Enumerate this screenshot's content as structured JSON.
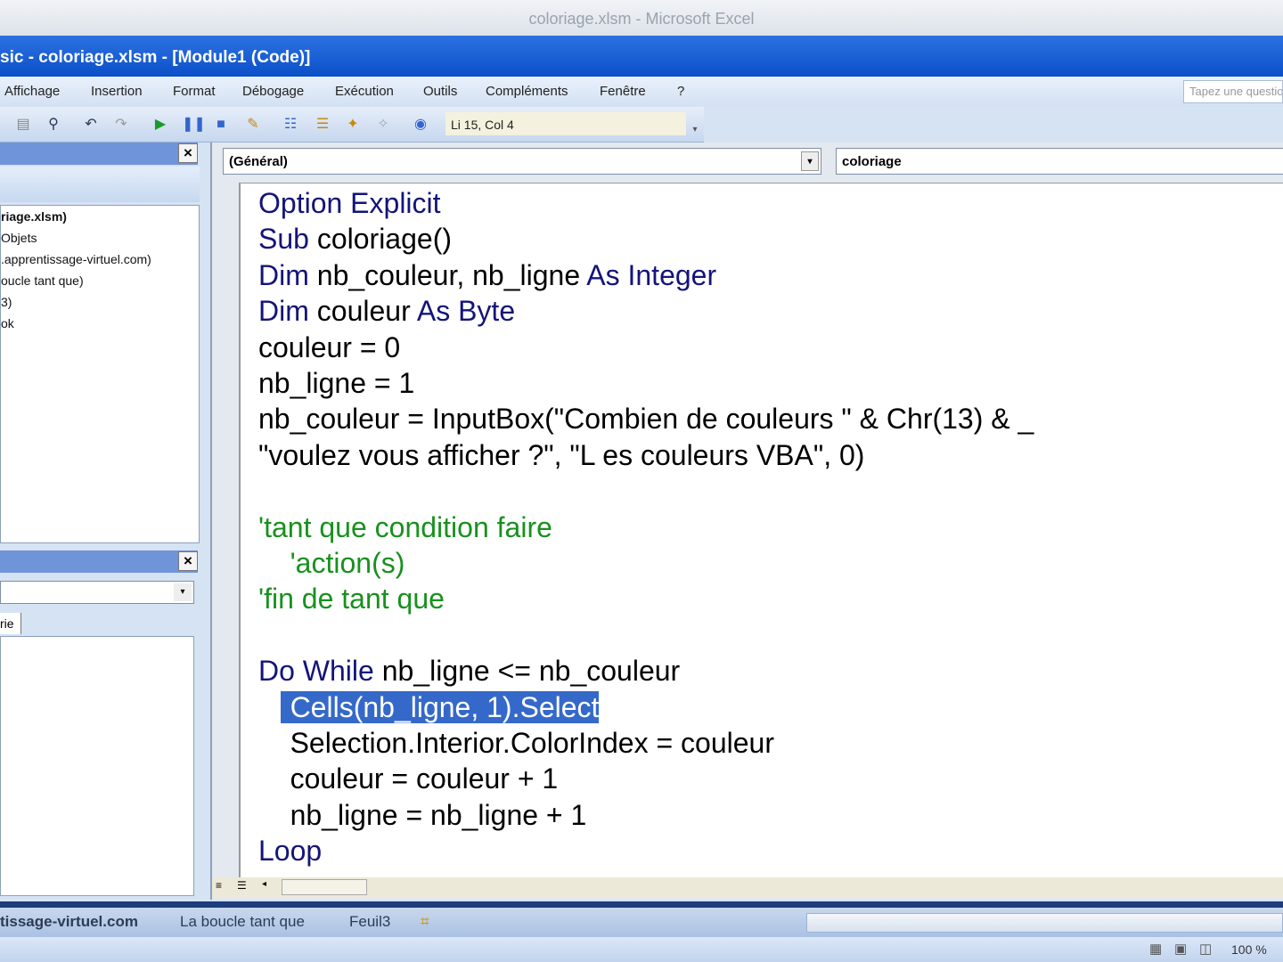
{
  "excel_title": "coloriage.xlsm - Microsoft Excel",
  "vbe_title": "sic - coloriage.xlsm - [Module1 (Code)]",
  "menu": [
    "Affichage",
    "Insertion",
    "Format",
    "Débogage",
    "Exécution",
    "Outils",
    "Compléments",
    "Fenêtre",
    "?"
  ],
  "help_placeholder": "Tapez une question",
  "cursor_position": "Li 15, Col 4",
  "project_tree": [
    "riage.xlsm)",
    "Objets",
    ".apprentissage-virtuel.com)",
    "oucle tant que)",
    "3)",
    "ok"
  ],
  "properties_tab": "rie",
  "object_combo": "(Général)",
  "procedure_combo": "coloriage",
  "code_lines": [
    [
      [
        "kw",
        "Option Explicit"
      ]
    ],
    [
      [
        "kw",
        "Sub "
      ],
      [
        "",
        "coloriage()"
      ]
    ],
    [
      [
        "kw",
        "Dim "
      ],
      [
        "",
        "nb_couleur, nb_ligne "
      ],
      [
        "kw",
        "As Integer"
      ]
    ],
    [
      [
        "kw",
        "Dim "
      ],
      [
        "",
        "couleur "
      ],
      [
        "kw",
        "As Byte"
      ]
    ],
    [
      [
        "",
        "couleur = 0"
      ]
    ],
    [
      [
        "",
        "nb_ligne = 1"
      ]
    ],
    [
      [
        "",
        "nb_couleur = InputBox(\"Combien de couleurs \" & Chr(13) & _"
      ]
    ],
    [
      [
        "",
        "\"voulez vous afficher ?\", \"L es couleurs VBA\", 0)"
      ]
    ],
    [],
    [
      [
        "cm",
        "'tant que condition faire"
      ]
    ],
    [
      [
        "cm",
        "    'action(s)"
      ]
    ],
    [
      [
        "cm",
        "'fin de tant que"
      ]
    ],
    [],
    [
      [
        "kw",
        "Do While "
      ],
      [
        "",
        "nb_ligne <= nb_couleur"
      ]
    ],
    [
      [
        "",
        "    "
      ],
      [
        "sel",
        "Cells(nb_ligne, 1).Select"
      ]
    ],
    [
      [
        "",
        "    Selection.Interior.ColorIndex = couleur"
      ]
    ],
    [
      [
        "",
        "    couleur = couleur + 1"
      ]
    ],
    [
      [
        "",
        "    nb_ligne = nb_ligne + 1"
      ]
    ],
    [
      [
        "kw",
        "Loop"
      ]
    ]
  ],
  "sheet_tabs": [
    "tissage-virtuel.com",
    "La boucle tant que",
    "Feuil3"
  ],
  "zoom": "100 %",
  "colors": {
    "keyword": "#14147a",
    "comment": "#18911e",
    "selection": "#3569c9",
    "title_bar": "#0b4fc8"
  }
}
